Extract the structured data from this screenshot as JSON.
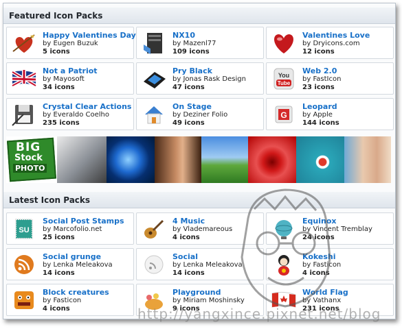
{
  "featured": {
    "header": "Featured Icon Packs",
    "packs": [
      {
        "title": "Happy Valentines Day",
        "by": "by Eugen Buzuk",
        "count": "5 icons",
        "icon": "cupid-heart-icon"
      },
      {
        "title": "NX10",
        "by": "by Mazenl77",
        "count": "109 icons",
        "icon": "server-icon"
      },
      {
        "title": "Valentines Love",
        "by": "by Dryicons.com",
        "count": "12 icons",
        "icon": "heart-icon"
      },
      {
        "title": "Not a Patriot",
        "by": "by Mayosoft",
        "count": "34 icons",
        "icon": "uk-flag-icon"
      },
      {
        "title": "Pry Black",
        "by": "by Jonas Rask Design",
        "count": "47 icons",
        "icon": "black-folder-icon"
      },
      {
        "title": "Web 2.0",
        "by": "by FastIcon",
        "count": "23 icons",
        "icon": "youtube-icon"
      },
      {
        "title": "Crystal Clear Actions",
        "by": "by Everaldo Coelho",
        "count": "235 icons",
        "icon": "save-disk-icon"
      },
      {
        "title": "On Stage",
        "by": "by Deziner Folio",
        "count": "49 icons",
        "icon": "house-icon"
      },
      {
        "title": "Leopard",
        "by": "by Apple",
        "count": "144 icons",
        "icon": "leopard-app-icon"
      }
    ]
  },
  "banner": {
    "logo_line1": "BIG",
    "logo_line2": "Stock",
    "logo_line3": "PHOTO"
  },
  "latest": {
    "header": "Latest Icon Packs",
    "packs": [
      {
        "title": "Social Post Stamps",
        "by": "by Marcofolio.net",
        "count": "25 icons",
        "icon": "stumbleupon-stamp-icon"
      },
      {
        "title": "4 Music",
        "by": "by Vlademareous",
        "count": "4 icons",
        "icon": "guitar-icon"
      },
      {
        "title": "Equinox",
        "by": "by Vincent Tremblay",
        "count": "24 icons",
        "icon": "globe-icon"
      },
      {
        "title": "Social grunge",
        "by": "by Lenka Meleakova",
        "count": "14 icons",
        "icon": "rss-grunge-icon"
      },
      {
        "title": "Social",
        "by": "by Lenka Meleakova",
        "count": "14 icons",
        "icon": "social-paper-icon"
      },
      {
        "title": "Kokeshi",
        "by": "by Fasticon",
        "count": "4 icons",
        "icon": "kokeshi-doll-icon"
      },
      {
        "title": "Block creatures",
        "by": "by Fasticon",
        "count": "4 icons",
        "icon": "block-creature-icon"
      },
      {
        "title": "Playground",
        "by": "by Miriam Moshinsky",
        "count": "9 icons",
        "icon": "playground-icon"
      },
      {
        "title": "World Flag",
        "by": "by Vathanx",
        "count": "231 icons",
        "icon": "canada-flag-icon"
      }
    ]
  },
  "watermark": {
    "url": "http://yangxince.pixnet.net/blog"
  }
}
